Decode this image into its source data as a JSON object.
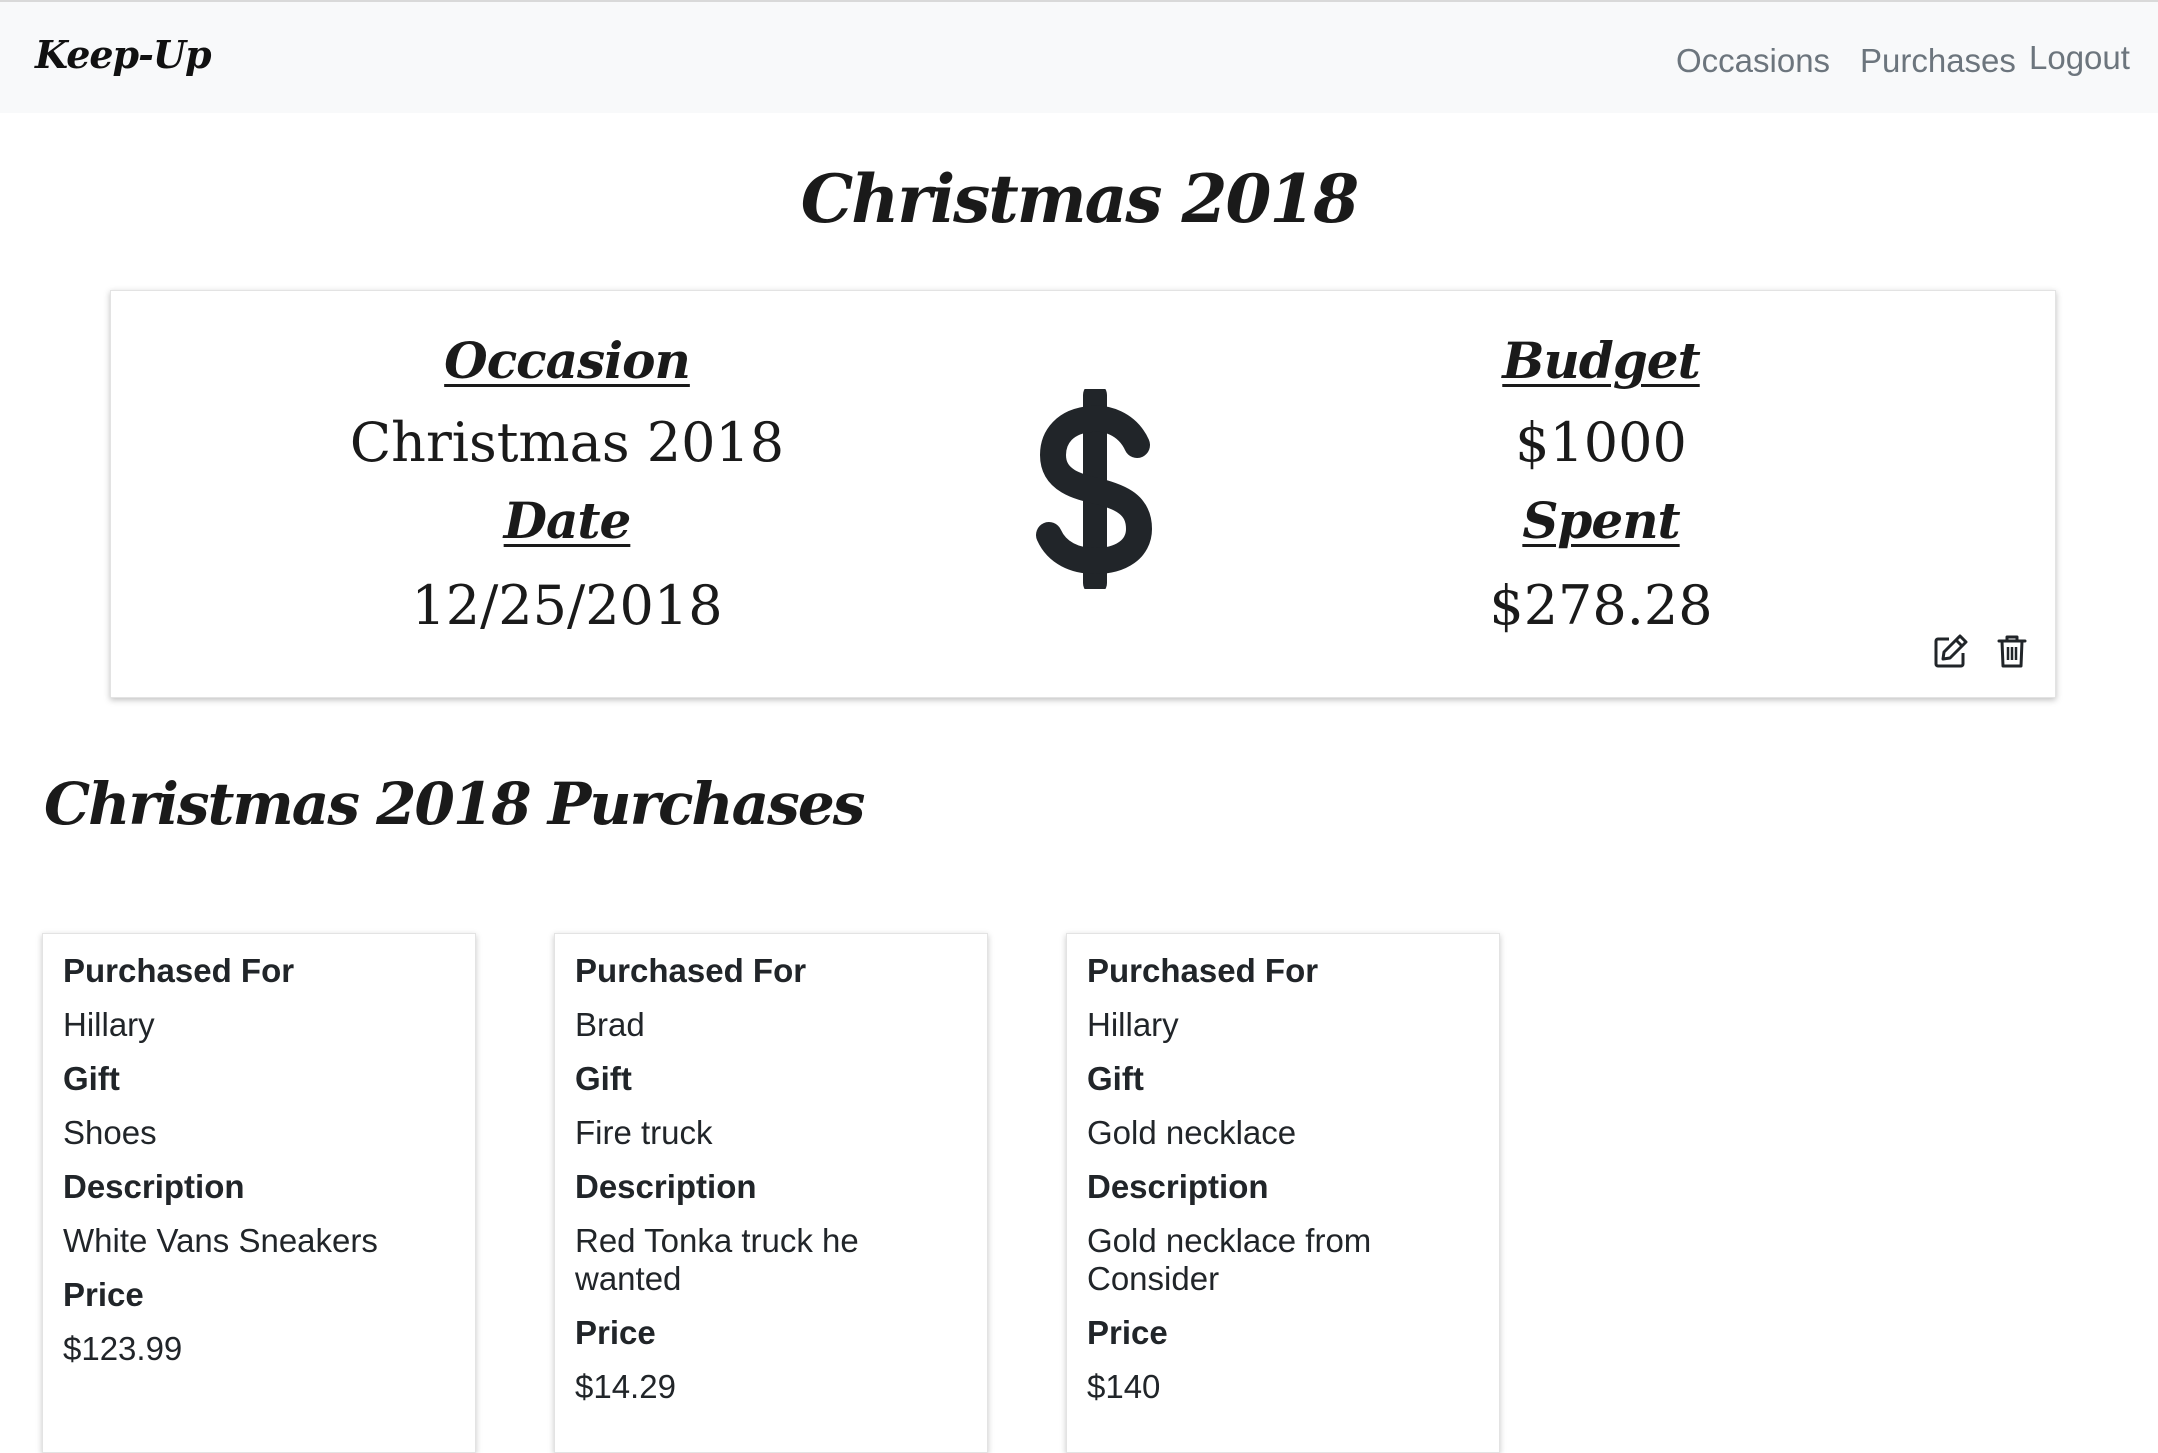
{
  "nav": {
    "brand": "Keep-Up",
    "links": [
      "Occasions",
      "Purchases",
      "Logout"
    ]
  },
  "page": {
    "title": "Christmas 2018"
  },
  "summary": {
    "occasion_label": "Occasion",
    "occasion_value": "Christmas 2018",
    "date_label": "Date",
    "date_value": "12/25/2018",
    "budget_label": "Budget",
    "budget_value": "$1000",
    "spent_label": "Spent",
    "spent_value": "$278.28",
    "center_icon": "dollar-sign-icon",
    "actions": [
      "edit-icon",
      "trash-icon"
    ]
  },
  "purchases": {
    "title": "Christmas 2018 Purchases",
    "labels": {
      "purchased_for": "Purchased For",
      "gift": "Gift",
      "description": "Description",
      "price": "Price"
    },
    "items": [
      {
        "purchased_for": "Hillary",
        "gift": "Shoes",
        "description": "White Vans Sneakers",
        "price": "$123.99"
      },
      {
        "purchased_for": "Brad",
        "gift": "Fire truck",
        "description": "Red Tonka truck he wanted",
        "price": "$14.29"
      },
      {
        "purchased_for": "Hillary",
        "gift": "Gold necklace",
        "description": "Gold necklace from Consider",
        "price": "$140"
      }
    ]
  }
}
